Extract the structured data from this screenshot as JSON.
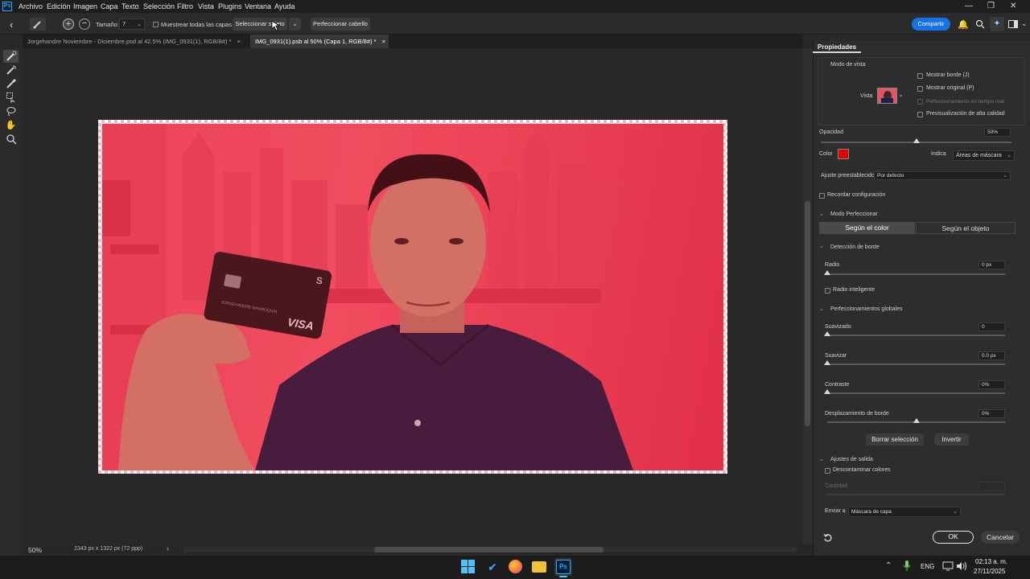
{
  "app": {
    "logo": "Ps"
  },
  "menu": [
    "Archivo",
    "Edición",
    "Imagen",
    "Capa",
    "Texto",
    "Selección",
    "Filtro",
    "Vista",
    "Plugins",
    "Ventana",
    "Ayuda"
  ],
  "window_controls": {
    "minimize": "—",
    "restore": "❐",
    "close": "✕"
  },
  "options_bar": {
    "size_label": "Tamaño:",
    "size_value": "7",
    "sample_all_label": "Muestrear todas las capas",
    "select_subject": "Seleccionar sujeto",
    "refine_hair": "Perfeccionar cabello",
    "share": "Compartir"
  },
  "tabs": [
    {
      "label": "Jorgehandre Noviembre - Diciembre.psd al 42.5% (IMG_0931(1), RGB/8#) *",
      "close": "×",
      "active": false
    },
    {
      "label": "IMG_0931(1).psb al 50% (Capa 1, RGB/8#) *",
      "close": "×",
      "active": true
    }
  ],
  "card": {
    "brand": "VISA",
    "name": "JORGEHANDRE MARROQUIN"
  },
  "status": {
    "zoom": "50%",
    "dimensions": "2343 px x 1322 px (72 ppp)",
    "arrow": "›"
  },
  "panel": {
    "title": "Propiedades",
    "view_mode_title": "Modo de vista",
    "view_label": "Vista",
    "show_edge": "Mostrar borde (J)",
    "show_original": "Mostrar original (P)",
    "realtime": "Perfeccionamiento en tiempo real",
    "hq_preview": "Previsualización de alta calidad",
    "opacity_label": "Opacidad",
    "opacity_value": "50%",
    "opacity_level": 0.5,
    "color_label": "Color",
    "mask_color": "#e00000",
    "indicates_label": "Indica",
    "indicates_value": "Áreas de máscara",
    "preset_label": "Ajuste preestablecido",
    "preset_value": "Por defecto",
    "remember": "Recordar configuración",
    "refine_mode_title": "Modo Perfeccionar",
    "mode_color": "Según el color",
    "mode_object": "Según el objeto",
    "edge_detection_title": "Detección de borde",
    "radius_label": "Radio",
    "radius_value": "0 px",
    "smart_radius": "Radio inteligente",
    "global_title": "Perfeccionamientos globales",
    "smooth_label": "Suavizado",
    "smooth_value": "0",
    "feather_label": "Suavizar",
    "feather_value": "0.0 px",
    "contrast_label": "Contraste",
    "contrast_value": "0%",
    "shift_label": "Desplazamiento de borde",
    "shift_value": "0%",
    "shift_level": 0.5,
    "clear_selection": "Borrar selección",
    "invert": "Invertir",
    "output_title": "Ajustes de salida",
    "decontaminate": "Descontaminar colores",
    "amount_label": "Cantidad",
    "send_to_label": "Enviar a",
    "send_to_value": "Máscara de capa",
    "ok": "OK",
    "cancel": "Cancelar"
  },
  "taskbar": {
    "lang": "ENG",
    "time": "02:13 a. m.",
    "date": "27/11/2025"
  }
}
